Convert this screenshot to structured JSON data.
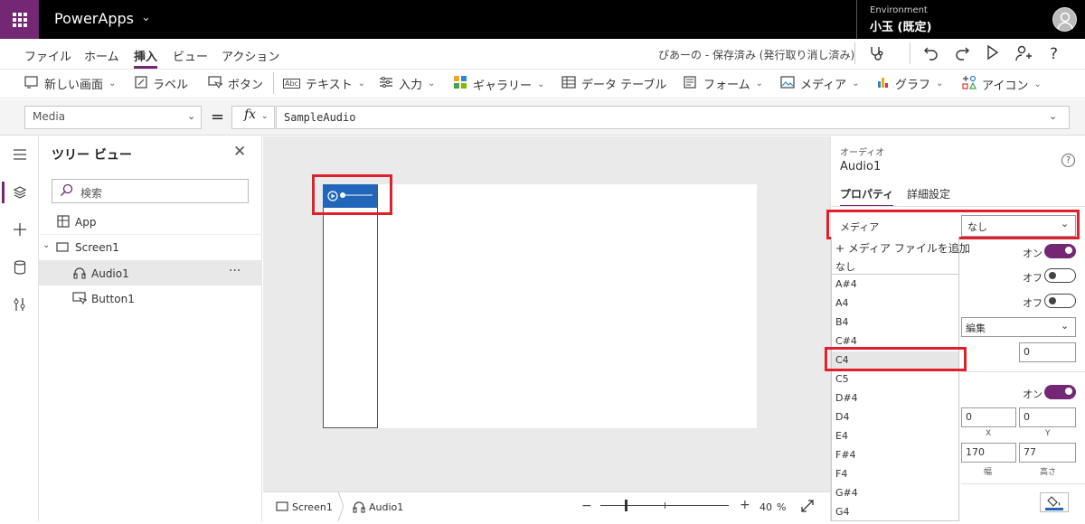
{
  "app": {
    "name": "PowerApps",
    "env_label": "Environment",
    "env_name": "小玉 (既定)"
  },
  "menu": [
    "ファイル",
    "ホーム",
    "挿入",
    "ビュー",
    "アクション"
  ],
  "status": "ぴあーの - 保存済み (発行取り消し済み)",
  "ribbon": [
    {
      "label": "新しい画面",
      "icon": "new-screen-icon",
      "chev": true
    },
    {
      "label": "ラベル",
      "icon": "label-icon",
      "chev": false
    },
    {
      "label": "ボタン",
      "icon": "button-icon",
      "chev": false
    },
    {
      "label": "テキスト",
      "icon": "text-icon",
      "chev": true
    },
    {
      "label": "入力",
      "icon": "input-icon",
      "chev": true
    },
    {
      "label": "ギャラリー",
      "icon": "gallery-icon",
      "chev": true
    },
    {
      "label": "データ テーブル",
      "icon": "data-table-icon",
      "chev": false
    },
    {
      "label": "フォーム",
      "icon": "form-icon",
      "chev": true
    },
    {
      "label": "メディア",
      "icon": "media-icon",
      "chev": true
    },
    {
      "label": "グラフ",
      "icon": "chart-icon",
      "chev": true
    },
    {
      "label": "アイコン",
      "icon": "icons-icon",
      "chev": true
    }
  ],
  "formula": {
    "property": "Media",
    "eq": "=",
    "fx": "fx",
    "value": "SampleAudio"
  },
  "tree": {
    "title": "ツリー ビュー",
    "search_placeholder": "検索",
    "items": [
      "App",
      "Screen1",
      "Audio1",
      "Button1"
    ],
    "more": "···"
  },
  "bottom": {
    "crumb1": "Screen1",
    "crumb2": "Audio1",
    "minus": "−",
    "plus": "+",
    "zoom": "40",
    "pct": "%"
  },
  "panel": {
    "type": "オーディオ",
    "name": "Audio1",
    "help": "?",
    "tab_props": "プロパティ",
    "tab_advanced": "詳細設定",
    "media_label": "メディア",
    "media_value": "なし",
    "add_media": "+ メディア ファイルを追加",
    "media_options": [
      "なし",
      "A#4",
      "A4",
      "B4",
      "C#4",
      "C4",
      "C5",
      "D#4",
      "D4",
      "E4",
      "F#4",
      "F4",
      "G#4",
      "G4"
    ],
    "selected_option": "C4",
    "toggle_on": "オン",
    "toggle_off": "オフ",
    "mode_value": "編集",
    "border_value": "0",
    "x_value": "0",
    "y_value": "0",
    "x_label": "X",
    "y_label": "Y",
    "w_value": "170",
    "h_value": "77",
    "w_label": "幅",
    "h_label": "高さ"
  }
}
